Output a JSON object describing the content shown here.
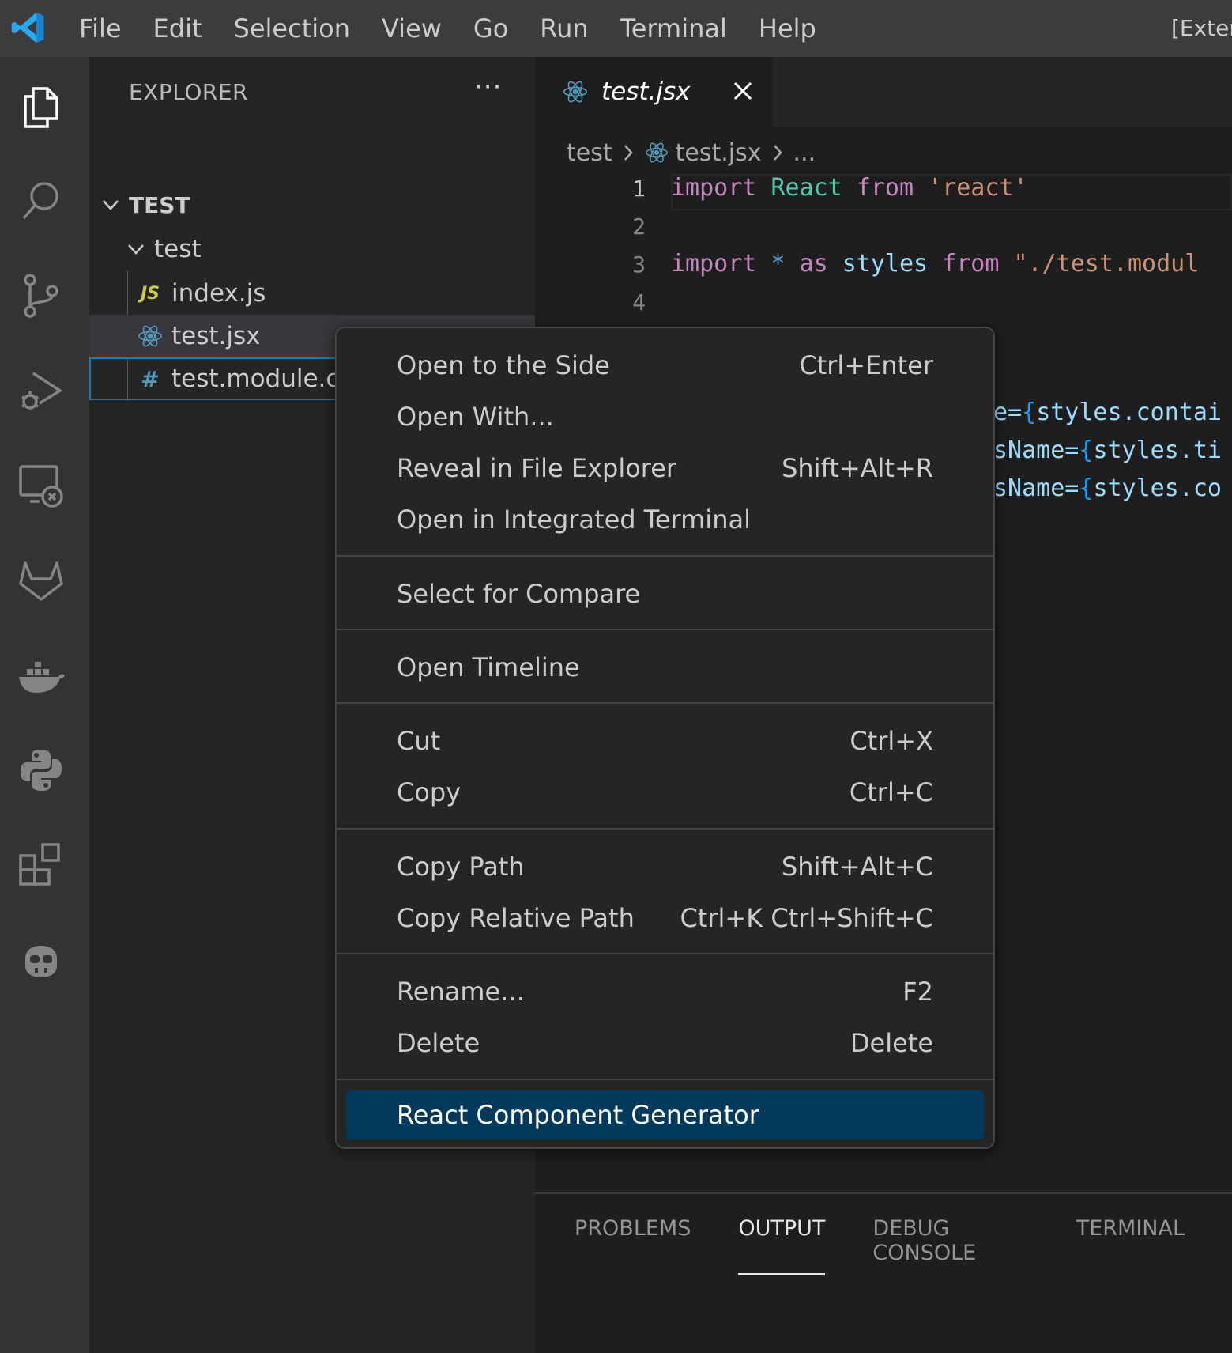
{
  "colors": {
    "accent": "#007fd4",
    "selection": "#04395e",
    "keyword": "#c586c0",
    "variable": "#9cdcfe",
    "class": "#4ec9b0",
    "string": "#ce9178"
  },
  "titlebar": {
    "menus": [
      "File",
      "Edit",
      "Selection",
      "View",
      "Go",
      "Run",
      "Terminal",
      "Help"
    ],
    "title": "[Exten"
  },
  "activitybar": {
    "icons": [
      "explorer-icon",
      "search-icon",
      "source-control-icon",
      "run-debug-icon",
      "remote-explorer-icon",
      "gitlab-icon",
      "docker-icon",
      "python-icon",
      "extensions-icon",
      "copilot-icon"
    ]
  },
  "sidebar": {
    "header": "EXPLORER",
    "more": "···",
    "root": "TEST",
    "folder": "test",
    "files": [
      {
        "name": "index.js",
        "icon": "js-icon",
        "badge": "JS"
      },
      {
        "name": "test.jsx",
        "icon": "react-icon"
      },
      {
        "name": "test.module.css",
        "icon": "css-icon",
        "badge": "#"
      }
    ]
  },
  "editor": {
    "tab": "test.jsx",
    "breadcrumbs": [
      "test",
      "test.jsx",
      "..."
    ],
    "line_numbers": [
      "1",
      "2",
      "3",
      "4"
    ],
    "code": {
      "l1": {
        "kw1": "import",
        "name": "React",
        "kw2": "from",
        "str": "'react'"
      },
      "l3": {
        "kw1": "import",
        "op": "*",
        "kw2": "as",
        "name": "styles",
        "kw3": "from",
        "str": "\"./test.modul"
      },
      "frag1": {
        "attr": "e=",
        "ob": "{",
        "expr": "styles.contai"
      },
      "frag2": {
        "attr": "sName=",
        "ob": "{",
        "expr": "styles.ti"
      },
      "frag3": {
        "attr": "sName=",
        "ob": "{",
        "expr": "styles.co"
      }
    }
  },
  "context_menu": {
    "groups": [
      [
        {
          "label": "Open to the Side",
          "shortcut": "Ctrl+Enter"
        },
        {
          "label": "Open With...",
          "shortcut": ""
        },
        {
          "label": "Reveal in File Explorer",
          "shortcut": "Shift+Alt+R"
        },
        {
          "label": "Open in Integrated Terminal",
          "shortcut": ""
        }
      ],
      [
        {
          "label": "Select for Compare",
          "shortcut": ""
        }
      ],
      [
        {
          "label": "Open Timeline",
          "shortcut": ""
        }
      ],
      [
        {
          "label": "Cut",
          "shortcut": "Ctrl+X"
        },
        {
          "label": "Copy",
          "shortcut": "Ctrl+C"
        }
      ],
      [
        {
          "label": "Copy Path",
          "shortcut": "Shift+Alt+C"
        },
        {
          "label": "Copy Relative Path",
          "shortcut": "Ctrl+K Ctrl+Shift+C"
        }
      ],
      [
        {
          "label": "Rename...",
          "shortcut": "F2"
        },
        {
          "label": "Delete",
          "shortcut": "Delete"
        }
      ],
      [
        {
          "label": "React Component Generator",
          "shortcut": ""
        }
      ]
    ]
  },
  "panel": {
    "tabs": [
      "PROBLEMS",
      "OUTPUT",
      "DEBUG CONSOLE",
      "TERMINAL"
    ],
    "active": "OUTPUT"
  }
}
